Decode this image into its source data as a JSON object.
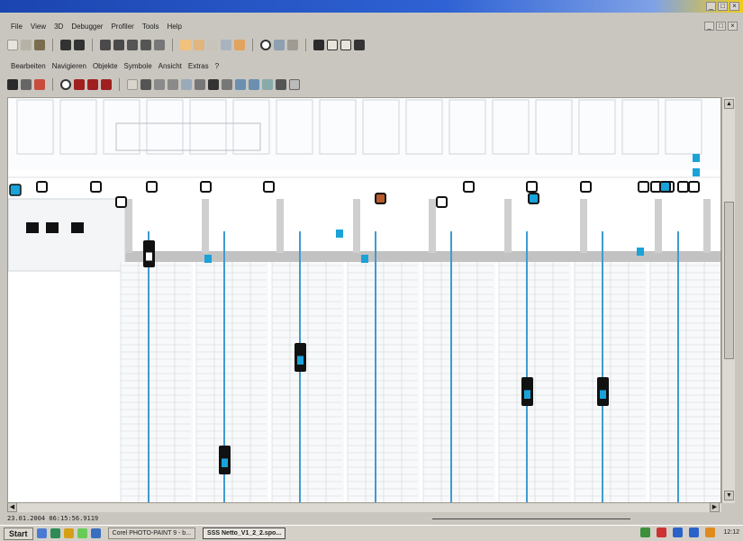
{
  "menubar": [
    "File",
    "View",
    "3D",
    "Debugger",
    "Profiler",
    "Tools",
    "Help"
  ],
  "menubar2": [
    "Bearbeiten",
    "Navigieren",
    "Objekte",
    "Symbole",
    "Ansicht",
    "Extras",
    "?"
  ],
  "statusbar": {
    "text": "23.01.2004 06:15:56.9119"
  },
  "taskbar": {
    "start": "Start",
    "tasks": [
      "Corel PHOTO-PAINT 9 - b...",
      "SSS Netto_V1_2_2.spo..."
    ],
    "clock": "12:12"
  },
  "colors": {
    "accent": "#1aa2d9",
    "blue_line": "#3f9bd0",
    "grid": "#cfd5da",
    "gray_band": "#c2c2c2"
  }
}
